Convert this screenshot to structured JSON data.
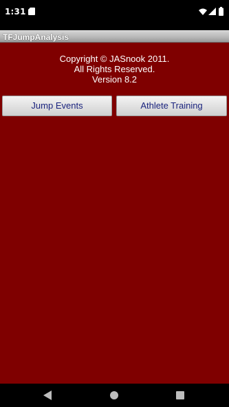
{
  "status_bar": {
    "time": "1:31",
    "icons": [
      "sd-card-icon",
      "wifi-icon",
      "signal-icon",
      "battery-icon"
    ]
  },
  "title_bar": {
    "title": "TFJumpAnalysis"
  },
  "main": {
    "copyright_lines": [
      "Copyright © JASnook 2011.",
      "All Rights Reserved.",
      "Version 8.2"
    ],
    "buttons": {
      "jump_events": "Jump Events",
      "athlete_training": "Athlete Training"
    }
  },
  "nav_bar": {
    "icons": [
      "back-icon",
      "home-icon",
      "recents-icon"
    ]
  },
  "colors": {
    "background": "#7f0000",
    "button_text": "#1a237e",
    "title_text": "#ffffff"
  }
}
